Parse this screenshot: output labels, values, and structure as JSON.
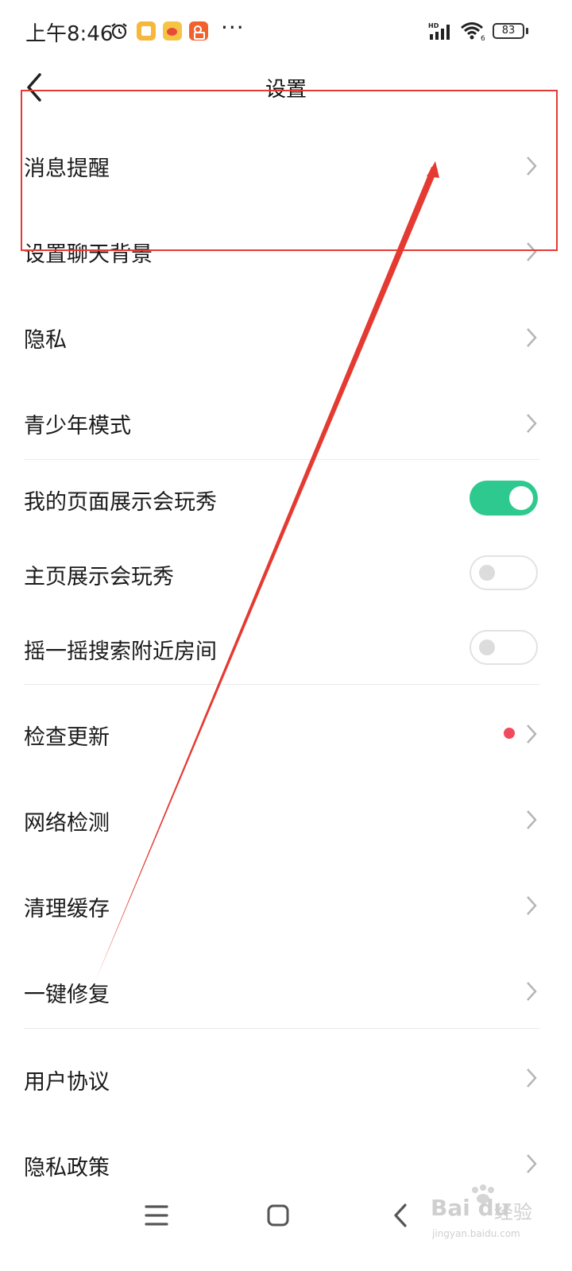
{
  "status_bar": {
    "time": "上午8:46",
    "more": "···",
    "battery": "83",
    "signal_label": "HD",
    "wifi_label": "6",
    "icons": [
      "alarm-icon",
      "notes-app-icon",
      "weibo-app-icon",
      "kuaishou-app-icon",
      "signal-icon",
      "wifi-icon",
      "battery-icon"
    ],
    "colors": {
      "notes_app": "#f6b73c",
      "weibo_app": "#f5c445",
      "kuaishou_app": "#f0612e"
    }
  },
  "header": {
    "title": "设置",
    "back_icon": "chevron-left-icon"
  },
  "settings": {
    "message_reminder": "消息提醒",
    "chat_background": "设置聊天背景",
    "privacy": "隐私",
    "teen_mode": "青少年模式",
    "my_page_show": {
      "label": "我的页面展示会玩秀",
      "on": true
    },
    "homepage_show": {
      "label": "主页展示会玩秀",
      "on": false
    },
    "shake_search": {
      "label": "摇一摇搜索附近房间",
      "on": false
    },
    "check_update": "检查更新",
    "network_check": "网络检测",
    "clear_cache": "清理缓存",
    "one_key_repair": "一键修复",
    "user_agreement": "用户协议",
    "privacy_policy": "隐私政策"
  },
  "colors": {
    "toggle_on": "#2ec98f",
    "badge_dot": "#f04b5c",
    "annotation": "#e43a32"
  },
  "nav_bar": {
    "icons": [
      "menu-icon",
      "home-square-icon",
      "back-triangle-icon"
    ]
  },
  "watermark": {
    "brand": "Bai du",
    "brand_cn": "经验",
    "url": "jingyan.baidu.com"
  }
}
